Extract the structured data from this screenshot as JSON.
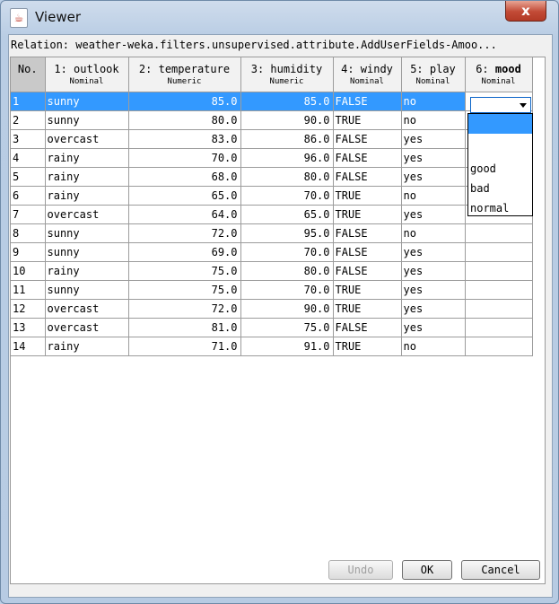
{
  "window": {
    "title": "Viewer",
    "app_icon": "java-cup-icon",
    "close_label": "x"
  },
  "relation_text": "Relation: weather-weka.filters.unsupervised.attribute.AddUserFields-Amoo...",
  "columns": [
    {
      "name": "No.",
      "type": ""
    },
    {
      "name": "1: outlook",
      "type": "Nominal"
    },
    {
      "name": "2: temperature",
      "type": "Numeric"
    },
    {
      "name": "3: humidity",
      "type": "Numeric"
    },
    {
      "name": "4: windy",
      "type": "Nominal"
    },
    {
      "name": "5: play",
      "type": "Nominal"
    },
    {
      "name": "6: ",
      "name_bold": "mood",
      "type": "Nominal"
    }
  ],
  "rows": [
    [
      "1",
      "sunny",
      "85.0",
      "85.0",
      "FALSE",
      "no",
      ""
    ],
    [
      "2",
      "sunny",
      "80.0",
      "90.0",
      "TRUE",
      "no",
      ""
    ],
    [
      "3",
      "overcast",
      "83.0",
      "86.0",
      "FALSE",
      "yes",
      ""
    ],
    [
      "4",
      "rainy",
      "70.0",
      "96.0",
      "FALSE",
      "yes",
      ""
    ],
    [
      "5",
      "rainy",
      "68.0",
      "80.0",
      "FALSE",
      "yes",
      ""
    ],
    [
      "6",
      "rainy",
      "65.0",
      "70.0",
      "TRUE",
      "no",
      ""
    ],
    [
      "7",
      "overcast",
      "64.0",
      "65.0",
      "TRUE",
      "yes",
      ""
    ],
    [
      "8",
      "sunny",
      "72.0",
      "95.0",
      "FALSE",
      "no",
      ""
    ],
    [
      "9",
      "sunny",
      "69.0",
      "70.0",
      "FALSE",
      "yes",
      ""
    ],
    [
      "10",
      "rainy",
      "75.0",
      "80.0",
      "FALSE",
      "yes",
      ""
    ],
    [
      "11",
      "sunny",
      "75.0",
      "70.0",
      "TRUE",
      "yes",
      ""
    ],
    [
      "12",
      "overcast",
      "72.0",
      "90.0",
      "TRUE",
      "yes",
      ""
    ],
    [
      "13",
      "overcast",
      "81.0",
      "75.0",
      "FALSE",
      "yes",
      ""
    ],
    [
      "14",
      "rainy",
      "71.0",
      "91.0",
      "TRUE",
      "no",
      ""
    ]
  ],
  "selected_row": 0,
  "mood_dropdown": {
    "selected": "",
    "options": [
      "good",
      "bad",
      "normal"
    ]
  },
  "buttons": {
    "undo": "Undo",
    "ok": "OK",
    "cancel": "Cancel"
  },
  "colors": {
    "selection": "#3399ff",
    "close_button": "#c24a36"
  }
}
